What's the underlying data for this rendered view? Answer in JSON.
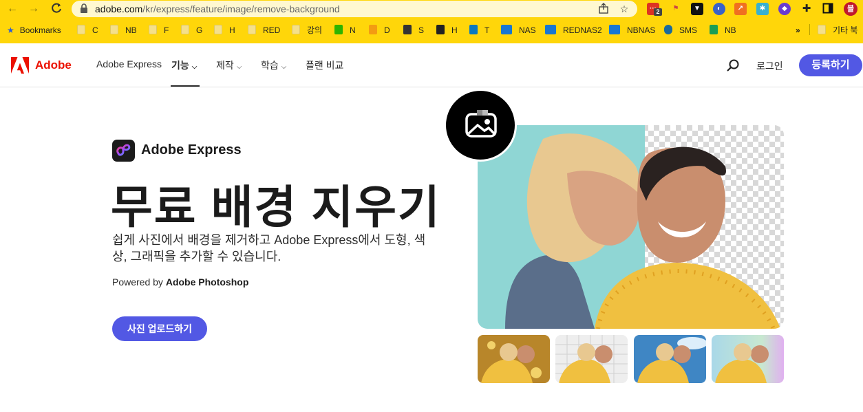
{
  "browser": {
    "url_host": "adobe.com",
    "url_path": "/kr/express/feature/image/remove-background",
    "bookmarks_label": "Bookmarks",
    "bookmarks": [
      {
        "label": "C"
      },
      {
        "label": "NB"
      },
      {
        "label": "F"
      },
      {
        "label": "G"
      },
      {
        "label": "H"
      },
      {
        "label": "RED"
      },
      {
        "label": "강의"
      },
      {
        "label": "N"
      },
      {
        "label": "D"
      },
      {
        "label": "S"
      },
      {
        "label": "H"
      },
      {
        "label": "T"
      },
      {
        "label": "NAS"
      },
      {
        "label": "REDNAS2"
      },
      {
        "label": "NBNAS"
      },
      {
        "label": "SMS"
      },
      {
        "label": "NB"
      }
    ],
    "more_chevron": "»",
    "other_bookmarks": "기타 북",
    "extension_badge": "2",
    "profile_text": "블"
  },
  "nav": {
    "brand": "Adobe",
    "items": [
      {
        "label": "Adobe Express"
      },
      {
        "label": "기능"
      },
      {
        "label": "제작"
      },
      {
        "label": "학습"
      },
      {
        "label": "플랜 비교"
      }
    ],
    "login": "로그인",
    "signup": "등록하기"
  },
  "hero": {
    "app_name": "Adobe Express",
    "title": "무료 배경 지우기",
    "description": "쉽게 사진에서 배경을 제거하고 Adobe Express에서 도형, 색상, 그래픽을 추가할 수 있습니다.",
    "powered_prefix": "Powered by",
    "powered_brand": "Adobe Photoshop",
    "cta": "사진 업로드하기"
  },
  "colors": {
    "chrome": "#FFD60A",
    "accent": "#5258E4",
    "adobe_red": "#EB1000"
  }
}
